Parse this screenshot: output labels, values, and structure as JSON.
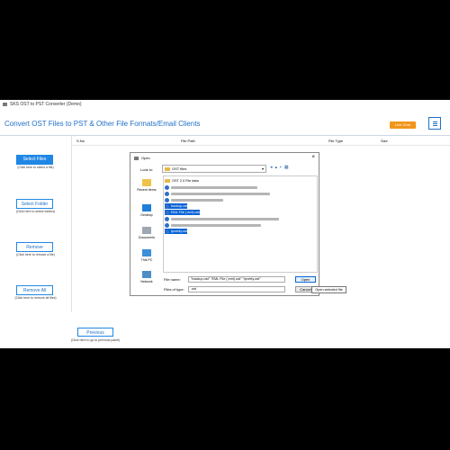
{
  "window": {
    "title": "SKS OST to PST Converter (Demo)"
  },
  "header": {
    "title": "Convert OST Files to PST & Other File Formats/Email Clients",
    "live_chat": "Live Chat"
  },
  "sidebar": [
    {
      "label": "Select Files",
      "hint": "(Click here to select a file)"
    },
    {
      "label": "Select Folder",
      "hint": "(Click here to select folders)"
    },
    {
      "label": "Remove",
      "hint": "(Click here to remove a file)"
    },
    {
      "label": "Remove All",
      "hint": "(Click here to remove all files)"
    }
  ],
  "grid": {
    "columns": [
      "S.No",
      "File Path",
      "File Type",
      "Size"
    ]
  },
  "footer": {
    "previous": "Previous",
    "previous_hint": "(Click here to go to previous panel)"
  },
  "dialog": {
    "title": "Open",
    "look_in_label": "Look in:",
    "look_in_value": "OST files",
    "places": [
      "Recent Items",
      "Desktop",
      "Documents",
      "This PC",
      "Network"
    ],
    "files": [
      "OST 2.0 File data",
      "backup.ost",
      "EML File (.eml).ost",
      "Ipverity.ost"
    ],
    "file_name_label": "File name:",
    "file_name_value": "\"backup.ost\" \"EML File (.eml).ost\" \"Ipverty.ost\"",
    "file_type_label": "Files of type:",
    "file_type_value": ".ost",
    "open_label": "Open",
    "cancel_label": "Cancel",
    "tooltip": "Open selected file"
  }
}
